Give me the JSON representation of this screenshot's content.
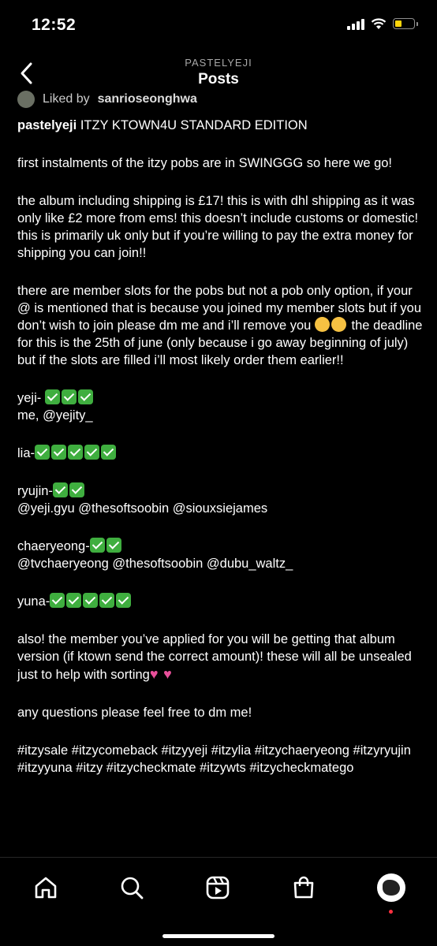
{
  "status_bar": {
    "time": "12:52"
  },
  "nav": {
    "username": "PASTELYEJI",
    "title": "Posts"
  },
  "liked_by": {
    "prefix": "Liked by",
    "user": "sanrioseonghwa"
  },
  "caption": {
    "username": "pastelyeji",
    "headline": "ITZY KTOWN4U STANDARD EDITION",
    "p1": "first instalments of the itzy pobs are in SWINGGG so here we go!",
    "p2": "the album including shipping is £17! this is with dhl shipping as it was only like £2 more from ems! this doesn’t include customs or domestic! this is primarily uk only but if you’re willing to pay the extra money for shipping you can join!!",
    "p3a": "there are member slots for the pobs but not a pob only option, if your @ is mentioned that is because you joined my member slots but if you don’t wish to join please dm me and i’ll remove you",
    "p3b": "the deadline for this is the 25th of june (only because i go away beginning of july) but if the slots are filled i’ll most likely order them earlier!!",
    "yeji_label": "yeji-",
    "yeji_members": "me, @yejity_",
    "lia_label": "lia-",
    "ryujin_label": "ryujin-",
    "ryujin_members": "@yeji.gyu @thesoftsoobin @siouxsiejames",
    "chaeryeong_label": "chaeryeong-",
    "chaeryeong_members": "@tvchaeryeong @thesoftsoobin @dubu_waltz_",
    "yuna_label": "yuna-",
    "p4": "also! the member you’ve applied for you will be getting that album version (if ktown send the correct amount)! these will all be unsealed just to help with sorting",
    "p5": "any questions please feel free to dm me!",
    "hashtags": "#itzysale #itzycomeback #itzyyeji #itzylia #itzychaeryeong #itzyryujin #itzyyuna #itzy #itzycheckmate #itzywts #itzycheckmatego"
  },
  "icons": [
    "back-chevron-icon",
    "home-icon",
    "search-icon",
    "reels-icon",
    "shop-icon",
    "profile-avatar"
  ],
  "colors": {
    "background": "#000000",
    "check": "#3fae3f",
    "battery": "#ffd60a",
    "notification_dot": "#ff3040"
  }
}
